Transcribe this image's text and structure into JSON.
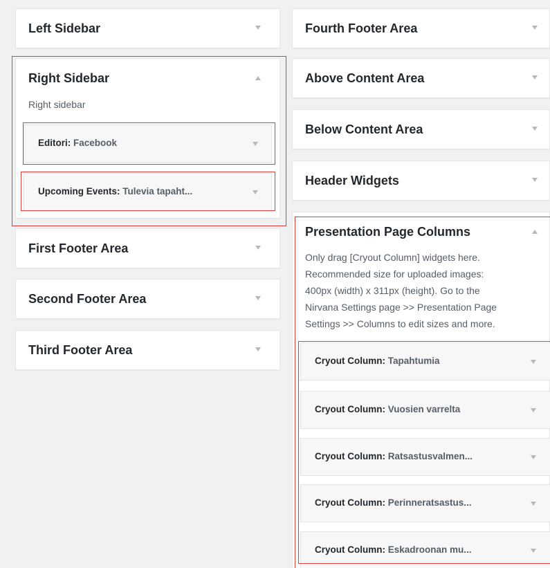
{
  "left_column": {
    "left_sidebar": {
      "title": "Left Sidebar"
    },
    "right_sidebar": {
      "title": "Right Sidebar",
      "description": "Right sidebar",
      "widgets": [
        {
          "name": "Editori",
          "instance": "Facebook"
        },
        {
          "name": "Upcoming Events",
          "instance": "Tulevia tapaht..."
        }
      ]
    },
    "first_footer": {
      "title": "First Footer Area"
    },
    "second_footer": {
      "title": "Second Footer Area"
    },
    "third_footer": {
      "title": "Third Footer Area"
    }
  },
  "right_column": {
    "fourth_footer": {
      "title": "Fourth Footer Area"
    },
    "above_content": {
      "title": "Above Content Area"
    },
    "below_content": {
      "title": "Below Content Area"
    },
    "header_widgets": {
      "title": "Header Widgets"
    },
    "presentation": {
      "title": "Presentation Page Columns",
      "description": [
        "Only drag [Cryout Column] widgets here.",
        "Recommended size for uploaded images:",
        "400px (width) x 311px (height). Go to the",
        "Nirvana Settings page >> Presentation Page",
        "Settings >> Columns to edit sizes and more."
      ],
      "widgets": [
        {
          "name": "Cryout Column",
          "instance": "Tapahtumia"
        },
        {
          "name": "Cryout Column",
          "instance": "Vuosien varrelta"
        },
        {
          "name": "Cryout Column",
          "instance": "Ratsastusvalmen..."
        },
        {
          "name": "Cryout Column",
          "instance": "Perinneratsastus..."
        },
        {
          "name": "Cryout Column",
          "instance": "Eskadroonan mu..."
        }
      ]
    }
  },
  "colors": {
    "highlight": "#e03c3c",
    "arrow": "#b4b9be",
    "background": "#f1f1f1"
  }
}
